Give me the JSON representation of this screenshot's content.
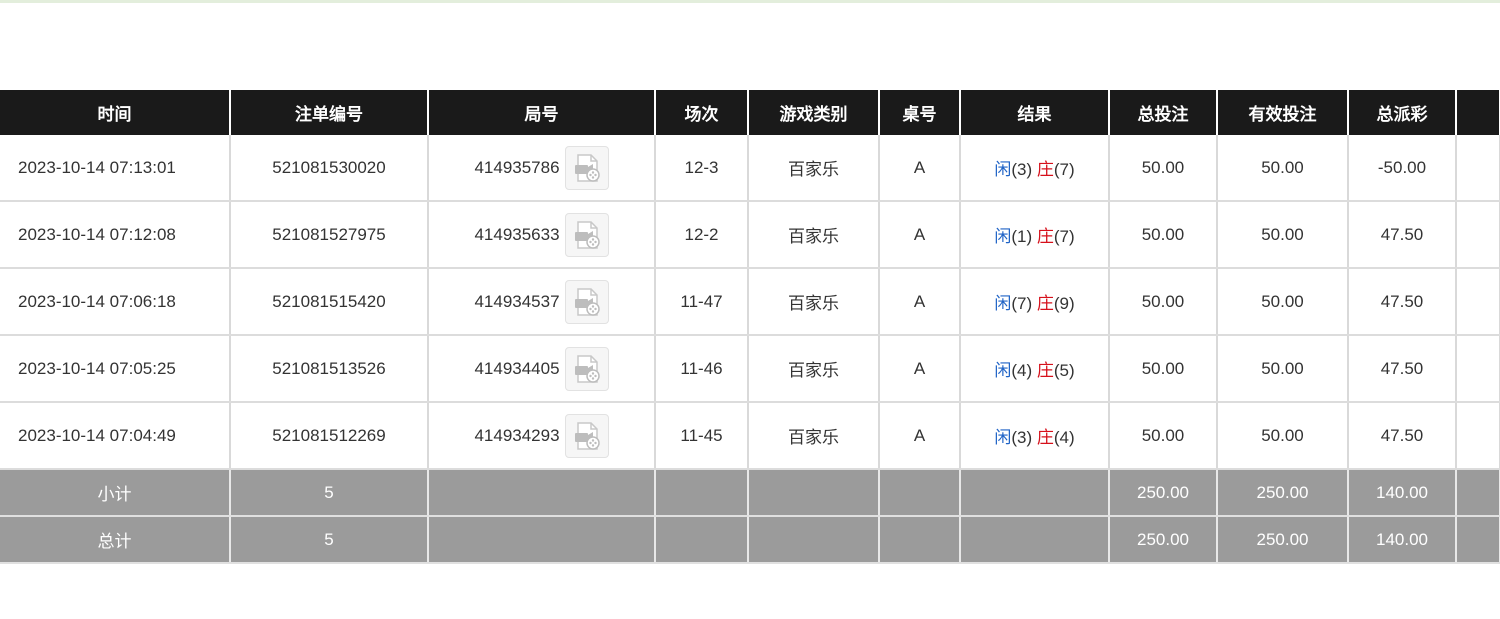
{
  "colors": {
    "header_bg": "#1a1a1a",
    "footer_bg": "#9b9b9b",
    "player": "#1f63c6",
    "banker": "#d6101b",
    "negative": "#d6101b",
    "bet": "#1f63c6"
  },
  "headers": [
    "时间",
    "注单编号",
    "局号",
    "场次",
    "游戏类别",
    "桌号",
    "结果",
    "总投注",
    "有效投注",
    "总派彩",
    ""
  ],
  "rows": [
    {
      "time": "2023-10-14 07:13:01",
      "bet_id": "521081530020",
      "round_id": "414935786",
      "session": "12-3",
      "game": "百家乐",
      "table": "A",
      "player_label": "闲",
      "player_score": "(3)",
      "banker_label": "庄",
      "banker_score": "(7)",
      "total_bet": "50.00",
      "valid_bet": "50.00",
      "payout": "-50.00",
      "payout_color": "red"
    },
    {
      "time": "2023-10-14 07:12:08",
      "bet_id": "521081527975",
      "round_id": "414935633",
      "session": "12-2",
      "game": "百家乐",
      "table": "A",
      "player_label": "闲",
      "player_score": "(1)",
      "banker_label": "庄",
      "banker_score": "(7)",
      "total_bet": "50.00",
      "valid_bet": "50.00",
      "payout": "47.50",
      "payout_color": "normal"
    },
    {
      "time": "2023-10-14 07:06:18",
      "bet_id": "521081515420",
      "round_id": "414934537",
      "session": "11-47",
      "game": "百家乐",
      "table": "A",
      "player_label": "闲",
      "player_score": "(7)",
      "banker_label": "庄",
      "banker_score": "(9)",
      "total_bet": "50.00",
      "valid_bet": "50.00",
      "payout": "47.50",
      "payout_color": "normal"
    },
    {
      "time": "2023-10-14 07:05:25",
      "bet_id": "521081513526",
      "round_id": "414934405",
      "session": "11-46",
      "game": "百家乐",
      "table": "A",
      "player_label": "闲",
      "player_score": "(4)",
      "banker_label": "庄",
      "banker_score": "(5)",
      "total_bet": "50.00",
      "valid_bet": "50.00",
      "payout": "47.50",
      "payout_color": "normal"
    },
    {
      "time": "2023-10-14 07:04:49",
      "bet_id": "521081512269",
      "round_id": "414934293",
      "session": "11-45",
      "game": "百家乐",
      "table": "A",
      "player_label": "闲",
      "player_score": "(3)",
      "banker_label": "庄",
      "banker_score": "(4)",
      "total_bet": "50.00",
      "valid_bet": "50.00",
      "payout": "47.50",
      "payout_color": "normal"
    }
  ],
  "replay_icon": "video-replay-icon",
  "subtotal": {
    "label": "小计",
    "count": "5",
    "total_bet": "250.00",
    "valid_bet": "250.00",
    "payout": "140.00"
  },
  "total": {
    "label": "总计",
    "count": "5",
    "total_bet": "250.00",
    "valid_bet": "250.00",
    "payout": "140.00"
  }
}
